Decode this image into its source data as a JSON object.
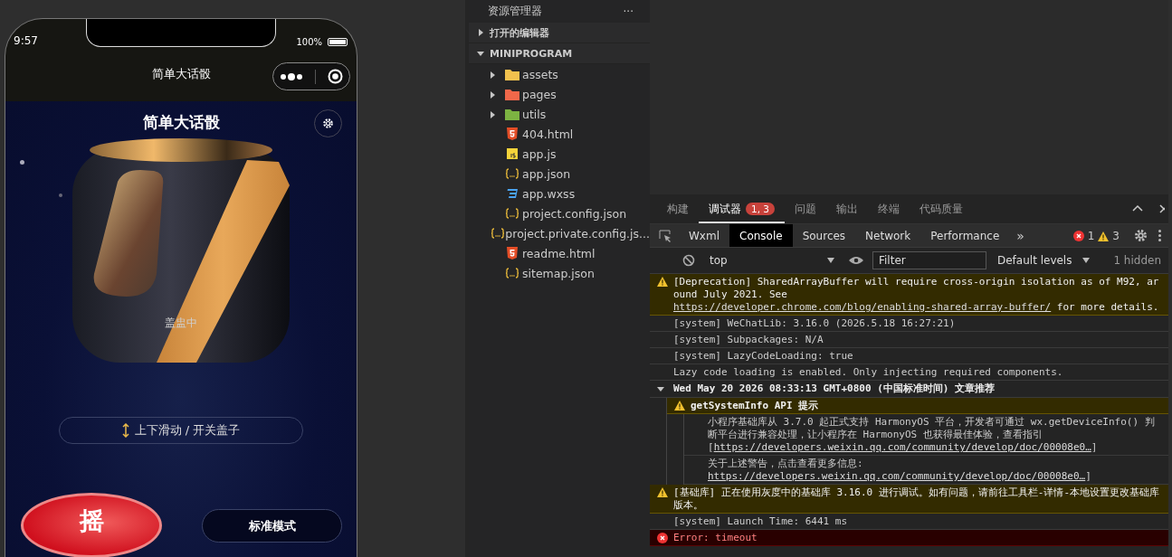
{
  "simulator": {
    "status_bar": {
      "time": "9:57",
      "battery": "100%"
    },
    "nav_bar": {
      "title": "简单大话骰"
    },
    "page": {
      "title": "简单大话骰",
      "cup_status": "盖盅中",
      "hint": "上下滑动 / 开关盖子",
      "shake_button": "摇",
      "mode_button": "标准模式"
    }
  },
  "explorer": {
    "title": "资源管理器",
    "more": "···",
    "sections": [
      {
        "label": "打开的编辑器",
        "expanded": false
      },
      {
        "label": "MINIPROGRAM",
        "expanded": true
      }
    ],
    "tree": [
      {
        "name": "assets",
        "kind": "folder",
        "color": "#f2c14e",
        "expanded": false
      },
      {
        "name": "pages",
        "kind": "folder",
        "color": "#f0684a",
        "expanded": false
      },
      {
        "name": "utils",
        "kind": "folder",
        "color": "#7cb342",
        "expanded": false
      },
      {
        "name": "404.html",
        "kind": "html"
      },
      {
        "name": "app.js",
        "kind": "js"
      },
      {
        "name": "app.json",
        "kind": "json"
      },
      {
        "name": "app.wxss",
        "kind": "wxss"
      },
      {
        "name": "project.config.json",
        "kind": "json"
      },
      {
        "name": "project.private.config.js...",
        "kind": "json"
      },
      {
        "name": "readme.html",
        "kind": "html"
      },
      {
        "name": "sitemap.json",
        "kind": "json"
      }
    ]
  },
  "devtools": {
    "tabs": [
      {
        "label": "构建",
        "selected": false
      },
      {
        "label": "调试器",
        "selected": true,
        "badge": "1, 3"
      },
      {
        "label": "问题",
        "selected": false
      },
      {
        "label": "输出",
        "selected": false
      },
      {
        "label": "终端",
        "selected": false
      },
      {
        "label": "代码质量",
        "selected": false
      }
    ],
    "panel_tabs": [
      {
        "label": "Wxml",
        "selected": false
      },
      {
        "label": "Console",
        "selected": true
      },
      {
        "label": "Sources",
        "selected": false
      },
      {
        "label": "Network",
        "selected": false
      },
      {
        "label": "Performance",
        "selected": false
      }
    ],
    "more_tabs": "»",
    "error_count": "1",
    "warning_count": "3",
    "toolbar": {
      "context": "top",
      "filter_placeholder": "Filter",
      "levels": "Default levels",
      "hidden": "1 hidden"
    },
    "messages": [
      {
        "kind": "warning",
        "parts": [
          {
            "text": "[Deprecation] SharedArrayBuffer will require cross-origin isolation as of M92, around July 2021. See "
          },
          {
            "link": "https://developer.chrome.com/blog/enabling-shared-array-buffer/"
          },
          {
            "text": " for more details."
          }
        ]
      },
      {
        "kind": "info",
        "parts": [
          {
            "text": "[system] WeChatLib: 3.16.0 (2026.5.18 16:27:21)"
          }
        ]
      },
      {
        "kind": "info",
        "parts": [
          {
            "text": "[system] Subpackages: N/A"
          }
        ]
      },
      {
        "kind": "info",
        "parts": [
          {
            "text": "[system] LazyCodeLoading: true"
          }
        ]
      },
      {
        "kind": "info",
        "parts": [
          {
            "text": "Lazy code loading is enabled. Only injecting required components."
          }
        ]
      },
      {
        "kind": "group",
        "expanded": true,
        "parts": [
          {
            "text": "Wed May 20 2026 08:33:13 GMT+0800 (中国标准时间) 文章推荐"
          }
        ],
        "children": [
          {
            "kind": "warning",
            "bold": true,
            "parts": [
              {
                "text": "getSystemInfo API 提示"
              }
            ],
            "children": [
              {
                "kind": "info",
                "parts": [
                  {
                    "text": "小程序基础库从 3.7.0 起正式支持 HarmonyOS 平台，开发者可通过 wx.getDeviceInfo() 判断平台进行兼容处理，让小程序在 HarmonyOS 也获得最佳体验，查看指引["
                  },
                  {
                    "link": "https://developers.weixin.qq.com/community/develop/doc/00008e0…"
                  },
                  {
                    "text": "]"
                  }
                ]
              },
              {
                "kind": "info",
                "parts": [
                  {
                    "text": "关于上述警告，点击查看更多信息: "
                  },
                  {
                    "link": "https://developers.weixin.qq.com/community/develop/doc/00008e0…"
                  },
                  {
                    "text": "]"
                  }
                ]
              }
            ]
          }
        ]
      },
      {
        "kind": "warning",
        "parts": [
          {
            "text": "[基础库] 正在使用灰度中的基础库 3.16.0 进行调试。如有问题，请前往工具栏-详情-本地设置更改基础库版本。"
          }
        ]
      },
      {
        "kind": "info",
        "parts": [
          {
            "text": "[system] Launch Time: 6441 ms"
          }
        ]
      },
      {
        "kind": "error",
        "parts": [
          {
            "text": "Error: timeout"
          }
        ]
      }
    ]
  }
}
